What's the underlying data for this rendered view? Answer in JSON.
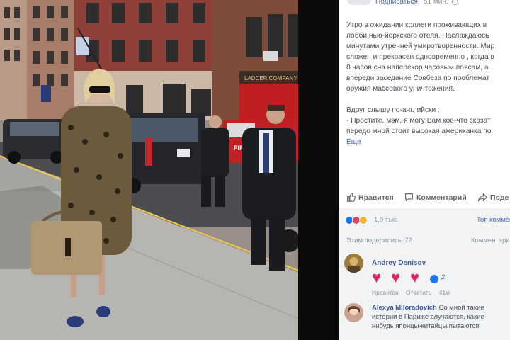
{
  "post": {
    "subscribe_label": "Подписаться",
    "time": "51 мин.",
    "body_lines": [
      "Утро в ожидании коллеги проживающих в",
      "лобби нью-йоркского отеля. Наслаждаюсь",
      "минутами утренней умиротворенности. Мир",
      "сложен и прекрасен одновременно , когда в",
      "8 часов сна наперекор часовым поясам, а",
      "впереди заседание Совбеза по проблемат",
      "оружия массового уничтожения."
    ],
    "body_lines_2": [
      "Вдруг слышу по-английски :",
      "- Простите, мэм, я могу Вам кое-что сказат",
      "передо мной стоит высокая американка по"
    ],
    "more_label": "Еще",
    "actions": {
      "like": "Нравится",
      "comment": "Комментарий",
      "share": "Поде"
    },
    "reactions_count": "1,9 тыс.",
    "top_comments": "Топ коммент",
    "shares_label": "Этим поделились",
    "shares_count": "72",
    "comments_label": "Комментари",
    "comments": [
      {
        "name": "Andrey Denisov",
        "hearts": [
          "♥",
          "♥",
          "♥"
        ],
        "badge_count": "2",
        "like_label": "Нравится",
        "reply_label": "Ответить",
        "time": "41м"
      },
      {
        "name": "Alexya Miloradovich",
        "text_lines": [
          "Со мной такие",
          "истории в Париже случаются, какие-",
          "нибудь японцы-китайцы пытаются"
        ]
      }
    ]
  },
  "photo": {
    "sign_fire": "FIRE",
    "sign_company": "LADDER COMPANY"
  },
  "colors": {
    "brand_blue": "#385898",
    "link_blue": "#4b69b2",
    "heart_red": "#e0245e",
    "comment_bg": "#f2f3f5"
  },
  "icons": {
    "like": "thumbs-up-icon",
    "comment": "speech-bubble-icon",
    "share": "share-arrow-icon",
    "globe": "globe-icon"
  }
}
